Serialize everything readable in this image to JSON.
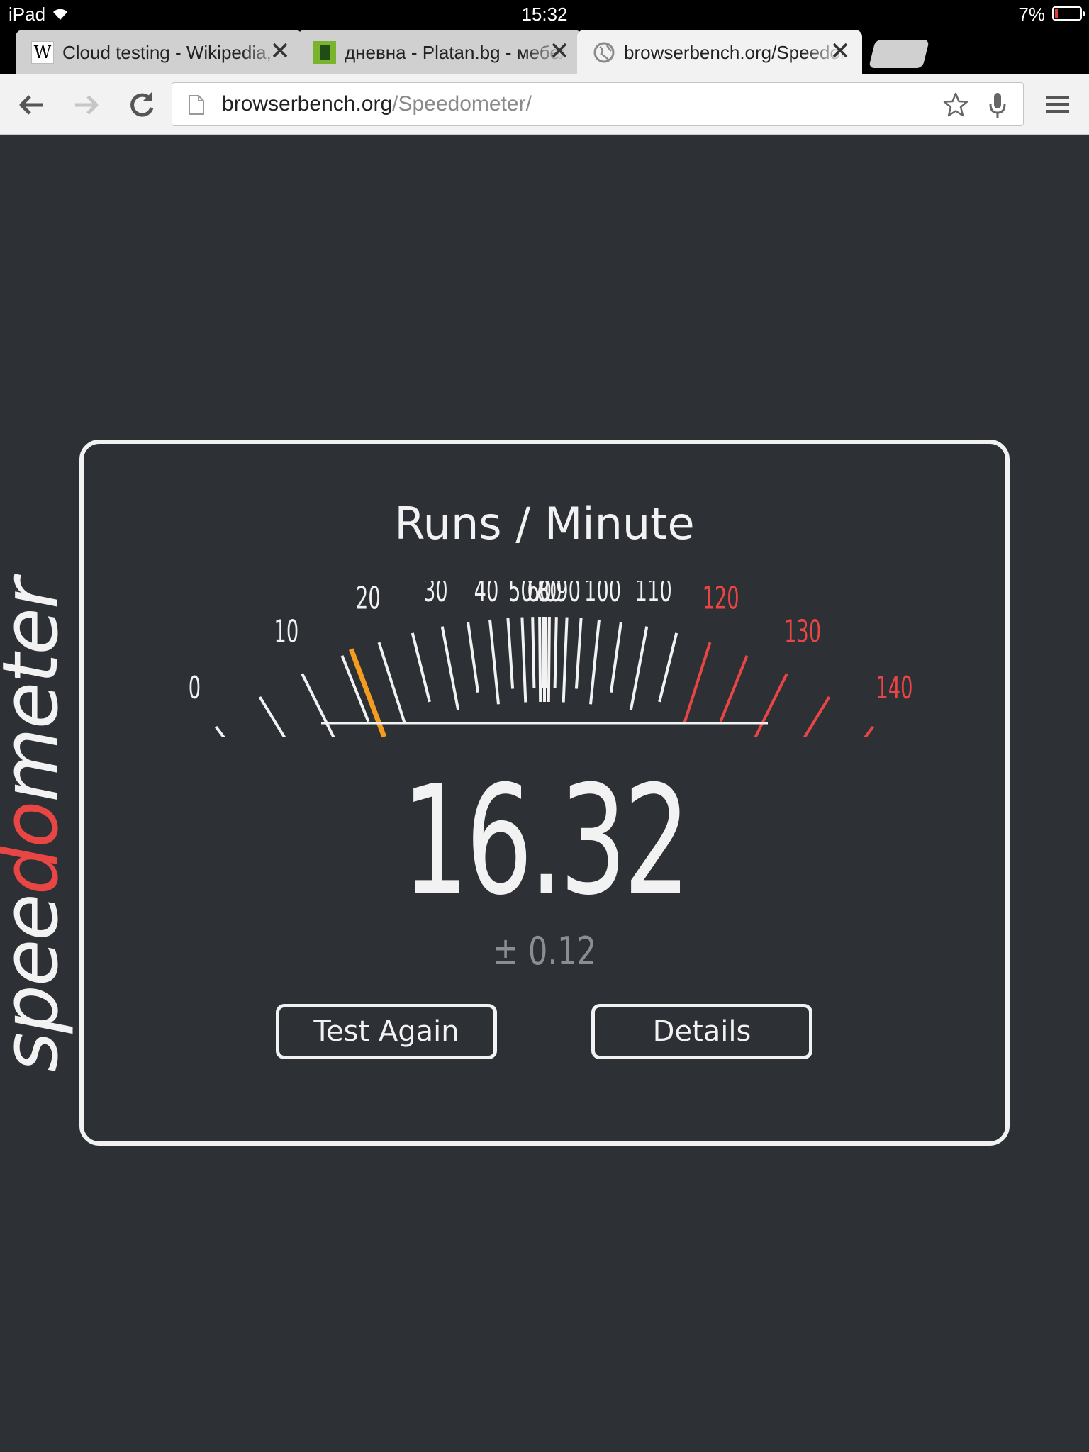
{
  "status_bar": {
    "device": "iPad",
    "time": "15:32",
    "battery": "7%",
    "battery_level": 0.07
  },
  "tabs": [
    {
      "title": "Cloud testing - Wikipedia,",
      "favicon": "wikipedia-icon",
      "active": false
    },
    {
      "title": "дневна - Platan.bg - мебели",
      "favicon": "platan-icon",
      "active": false
    },
    {
      "title": "browserbench.org/Speedometer/",
      "favicon": "globe-icon",
      "active": true
    }
  ],
  "toolbar": {
    "url_host": "browserbench.org",
    "url_path": "/Speedometer/"
  },
  "page": {
    "brand_pre": "spee",
    "brand_d": "d",
    "brand_o": "o",
    "brand_post": "meter",
    "gauge_title": "Runs / Minute",
    "score": "16.32",
    "margin": "± 0.12",
    "test_again_label": "Test Again",
    "details_label": "Details",
    "gauge_labels": [
      "0",
      "10",
      "20",
      "30",
      "40",
      "50",
      "60",
      "70",
      "80",
      "90",
      "100",
      "110",
      "120",
      "130",
      "140"
    ],
    "gauge_value": 16.32,
    "gauge_red_from": 120,
    "colors": {
      "background": "#2d3035",
      "foreground": "#f2f2f2",
      "needle": "#f39c1f",
      "redline": "#e84545",
      "muted": "#8a8d92"
    }
  }
}
